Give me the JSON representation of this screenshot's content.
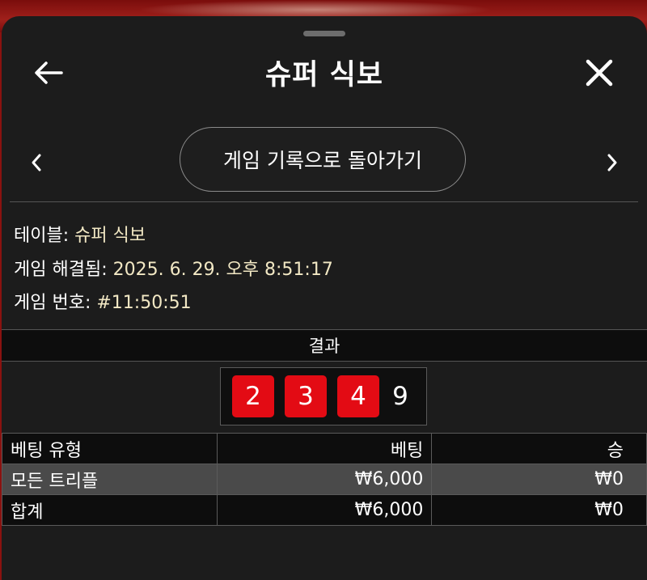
{
  "header": {
    "title": "슈퍼 식보"
  },
  "nav": {
    "return_label": "게임 기록으로 돌아가기"
  },
  "info": {
    "table_label": "테이블:",
    "table_value": "슈퍼 식보",
    "settled_label": "게임 해결됨:",
    "settled_value": "2025. 6. 29. 오후 8:51:17",
    "game_no_label": "게임 번호:",
    "game_no_value": "#11:50:51"
  },
  "results": {
    "header": "결과",
    "dice": [
      "2",
      "3",
      "4"
    ],
    "total": "9"
  },
  "bets_table": {
    "columns": [
      "베팅 유형",
      "베팅",
      "승"
    ],
    "rows": [
      {
        "type": "모든 트리플",
        "bet": "₩6,000",
        "win": "₩0"
      }
    ],
    "total": {
      "type": "합계",
      "bet": "₩6,000",
      "win": "₩0"
    }
  },
  "colors": {
    "die_red": "#e30b14",
    "value_text": "#f2e8c4",
    "sheet_bg": "#1c1c1c"
  },
  "icons": {
    "back": "arrow-left-icon",
    "close": "close-icon",
    "prev": "chevron-left-icon",
    "next": "chevron-right-icon"
  }
}
